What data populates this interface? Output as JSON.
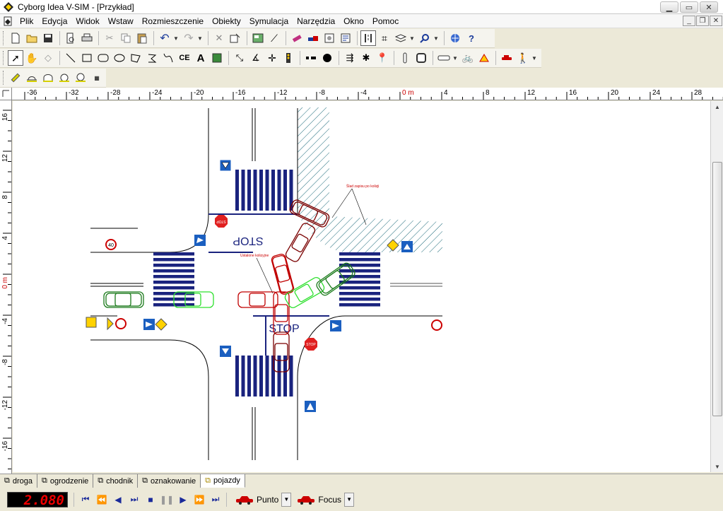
{
  "window": {
    "title": "Cyborg Idea V-SIM - [Przykład]"
  },
  "menu": [
    "Plik",
    "Edycja",
    "Widok",
    "Wstaw",
    "Rozmieszczenie",
    "Obiekty",
    "Symulacja",
    "Narzędzia",
    "Okno",
    "Pomoc"
  ],
  "ruler": {
    "h_labels": [
      "-36",
      "-32",
      "-28",
      "-24",
      "-20",
      "-16",
      "-12",
      "-8",
      "-4",
      "0 m",
      "4",
      "8",
      "12",
      "16",
      "20",
      "24",
      "28"
    ],
    "v_labels": [
      "16",
      "12",
      "8",
      "4",
      "0 m",
      "-4",
      "-8",
      "-12",
      "-16"
    ]
  },
  "drawing": {
    "stop_road_text": "STOP",
    "annotation_top": "Ślad zapisu po kolizji",
    "annotation_mid": "Ustalone kolizyjne",
    "sign_stop": "STOP",
    "speed_limit": "40"
  },
  "tabs": [
    "droga",
    "ogrodzenie",
    "chodnik",
    "oznakowanie",
    "pojazdy"
  ],
  "playbar": {
    "time": "2.080",
    "camera1": "Punto",
    "camera2": "Focus"
  },
  "colors": {
    "accent_red": "#c00000",
    "dark_red": "#7a0000",
    "green": "#2ee02e",
    "dark_green": "#1a7a1a",
    "road_blue": "#1a237e"
  }
}
